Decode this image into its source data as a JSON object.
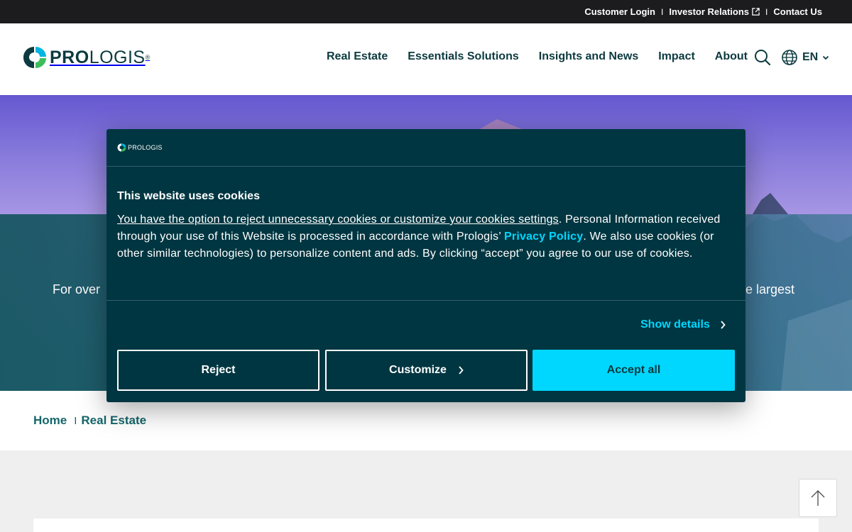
{
  "utility_nav": {
    "customer_login": "Customer Login",
    "separator": "I",
    "investor_relations": "Investor Relations",
    "contact_us": "Contact Us"
  },
  "header": {
    "logo_bold": "PRO",
    "logo_light": "LOGIS",
    "logo_reg": "®",
    "nav": [
      "Real Estate",
      "Essentials Solutions",
      "Insights and News",
      "Impact",
      "About"
    ],
    "language": "EN"
  },
  "hero": {
    "text_left": "For over",
    "text_right": "e largest"
  },
  "breadcrumb": {
    "home": "Home",
    "separator": "I",
    "current": "Real Estate"
  },
  "cookie_modal": {
    "logo_text": "PROLOGIS",
    "title": "This website uses cookies",
    "body_link": "You have the option to reject unnecessary cookies or customize your cookies settings",
    "body_part1": ". Personal Information received through your use of this Website is processed in accordance with Prologis’ ",
    "privacy_policy": "Privacy Policy",
    "body_part2": ".  We also use cookies (or other similar technologies) to personalize content and ads.  By clicking “accept” you agree to our use of cookies.",
    "show_details": "Show details",
    "reject": "Reject",
    "customize": "Customize",
    "accept_all": "Accept all"
  },
  "colors": {
    "brand_dark": "#0c3a3f",
    "modal_bg": "#003641",
    "accent_cyan": "#00d7ff",
    "breadcrumb_teal": "#14666a"
  }
}
